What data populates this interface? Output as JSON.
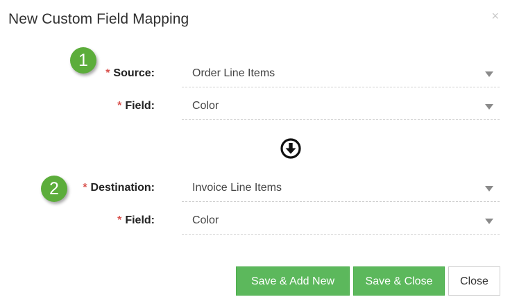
{
  "dialog": {
    "title": "New Custom Field Mapping",
    "close_glyph": "×"
  },
  "badges": [
    "1",
    "2"
  ],
  "source": {
    "required_mark": "*",
    "label": "Source:",
    "value": "Order Line Items",
    "field_label": "Field:",
    "field_value": "Color"
  },
  "direction_icon": "arrow-circle-down-icon",
  "destination": {
    "required_mark": "*",
    "label": "Destination:",
    "value": "Invoice Line Items",
    "field_label": "Field:",
    "field_value": "Color"
  },
  "buttons": {
    "save_add_new": "Save & Add New",
    "save_close": "Save & Close",
    "close": "Close"
  },
  "colors": {
    "badge": "#5cad3b",
    "primary_button": "#5cb85c",
    "required": "#d9534f"
  }
}
